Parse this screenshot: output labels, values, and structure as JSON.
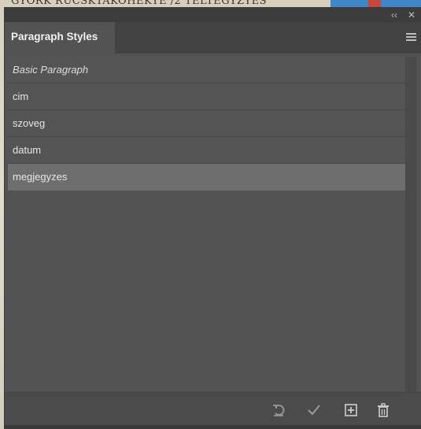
{
  "background": {
    "top_text": "GYORK RUCSKTAKOHEKYE  /2 TELTEGYZYES"
  },
  "panel": {
    "collapse_label": "‹‹",
    "close_label": "✕",
    "tab_title": "Paragraph Styles",
    "menu_icon": "hamburger-menu-icon"
  },
  "styles": [
    {
      "label": "Basic Paragraph",
      "italic": true,
      "selected": false
    },
    {
      "label": "cim",
      "italic": false,
      "selected": false
    },
    {
      "label": "szoveg",
      "italic": false,
      "selected": false
    },
    {
      "label": "datum",
      "italic": false,
      "selected": false
    },
    {
      "label": "megjegyzes",
      "italic": false,
      "selected": true
    }
  ],
  "toolbar": {
    "icons": [
      "revert-icon",
      "checkmark-icon",
      "new-style-icon",
      "trash-icon"
    ]
  },
  "colors": {
    "panel_bg": "#535353",
    "selected_row": "#6e6e6e",
    "text": "#e6e6e6"
  }
}
